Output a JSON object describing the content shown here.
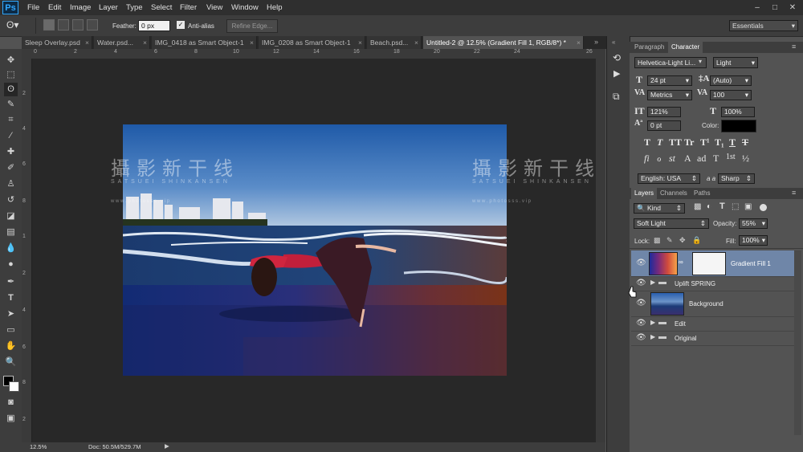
{
  "app": {
    "logo": "Ps"
  },
  "menu": [
    "File",
    "Edit",
    "Image",
    "Layer",
    "Type",
    "Select",
    "Filter",
    "View",
    "Window",
    "Help"
  ],
  "options": {
    "feather_label": "Feather:",
    "feather_value": "0 px",
    "antialias_label": "Anti-alias",
    "refine_label": "Refine Edge...",
    "workspace": "Essentials"
  },
  "tabs": [
    {
      "label": "Sleep Overlay.psd"
    },
    {
      "label": "Water.psd..."
    },
    {
      "label": "IMG_0418 as Smart Object-1"
    },
    {
      "label": "IMG_0208 as Smart Object-1"
    },
    {
      "label": "Beach.psd..."
    },
    {
      "label": "Untitled-2 @ 12.5% (Gradient Fill 1, RGB/8*) *"
    }
  ],
  "ruler_top": [
    "0",
    "2",
    "4",
    "6",
    "8",
    "10",
    "12",
    "14",
    "16",
    "18",
    "20",
    "22",
    "24",
    "26"
  ],
  "ruler_left": [
    "2",
    "4",
    "6",
    "8",
    "1",
    "2",
    "4",
    "6",
    "8",
    "2"
  ],
  "status": {
    "zoom": "12.5%",
    "doc": "Doc: 50.5M/529.7M"
  },
  "watermarks": {
    "title": "攝影新干线",
    "subtitle": "SATSUEI SHINKANSEN",
    "url": "w w w . p h o t o s s s . v i p"
  },
  "character": {
    "tab_paragraph": "Paragraph",
    "tab_character": "Character",
    "font_family": "Helvetica-Light Li...",
    "font_style": "Light",
    "size": "24 pt",
    "leading": "(Auto)",
    "kerning": "Metrics",
    "tracking": "100",
    "vscale": "121%",
    "hscale": "100%",
    "baseline": "0 pt",
    "color_label": "Color:",
    "language": "English: USA",
    "aa_label": "a a",
    "antialias": "Sharp",
    "typestyles": [
      "T",
      "T",
      "TT",
      "Tr",
      "T¹",
      "T₁",
      "T",
      "T"
    ],
    "otstyles": [
      "fi",
      "ℴ",
      "st",
      "A",
      "ad",
      "T",
      "1st",
      "½"
    ]
  },
  "layers": {
    "tab_layers": "Layers",
    "tab_channels": "Channels",
    "tab_paths": "Paths",
    "filter_kind": "Kind",
    "blend_mode": "Soft Light",
    "opacity_label": "Opacity:",
    "opacity": "55%",
    "lock_label": "Lock:",
    "fill_label": "Fill:",
    "fill": "100%",
    "items": [
      {
        "name": "Gradient Fill 1",
        "type": "fill"
      },
      {
        "name": "Uplift SPRING",
        "type": "group"
      },
      {
        "name": "Background",
        "type": "image"
      },
      {
        "name": "Edit",
        "type": "group"
      },
      {
        "name": "Original",
        "type": "group"
      }
    ]
  },
  "colors": {
    "accent": "#31a8ff",
    "selected_layer": "#6f86a8"
  }
}
